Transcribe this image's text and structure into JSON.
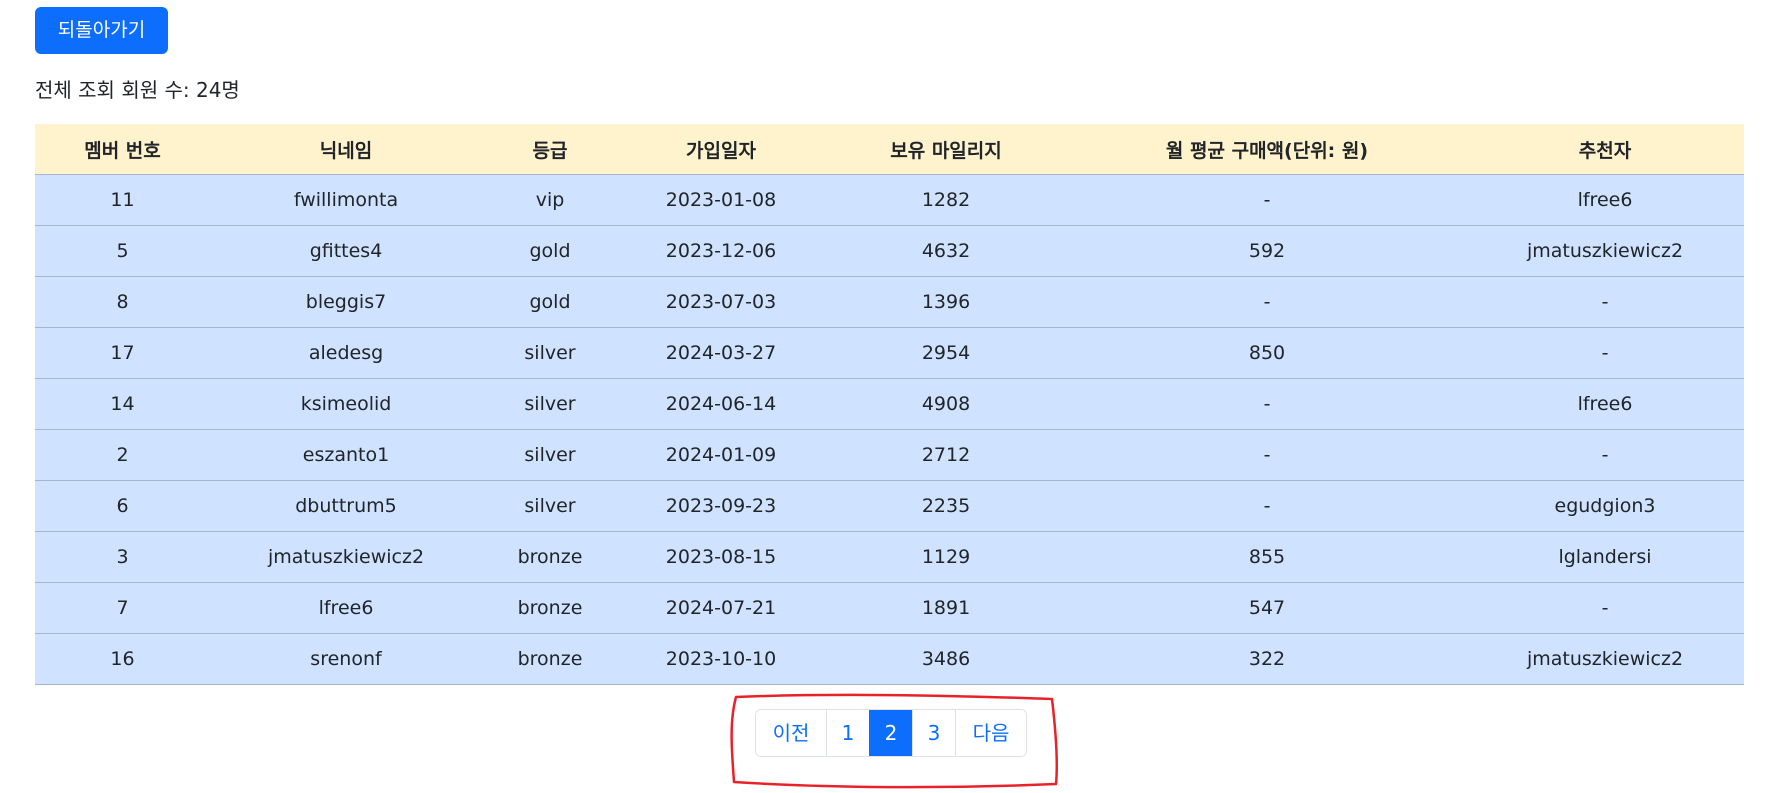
{
  "back_button": {
    "label": "되돌아가기"
  },
  "summary": {
    "text": "전체 조회 회원 수: 24명"
  },
  "table": {
    "headers": [
      "멤버 번호",
      "닉네임",
      "등급",
      "가입일자",
      "보유 마일리지",
      "월 평균 구매액(단위: 원)",
      "추천자"
    ],
    "rows": [
      [
        "11",
        "fwillimonta",
        "vip",
        "2023-01-08",
        "1282",
        "-",
        "lfree6"
      ],
      [
        "5",
        "gfittes4",
        "gold",
        "2023-12-06",
        "4632",
        "592",
        "jmatuszkiewicz2"
      ],
      [
        "8",
        "bleggis7",
        "gold",
        "2023-07-03",
        "1396",
        "-",
        "-"
      ],
      [
        "17",
        "aledesg",
        "silver",
        "2024-03-27",
        "2954",
        "850",
        "-"
      ],
      [
        "14",
        "ksimeolid",
        "silver",
        "2024-06-14",
        "4908",
        "-",
        "lfree6"
      ],
      [
        "2",
        "eszanto1",
        "silver",
        "2024-01-09",
        "2712",
        "-",
        "-"
      ],
      [
        "6",
        "dbuttrum5",
        "silver",
        "2023-09-23",
        "2235",
        "-",
        "egudgion3"
      ],
      [
        "3",
        "jmatuszkiewicz2",
        "bronze",
        "2023-08-15",
        "1129",
        "855",
        "lglandersi"
      ],
      [
        "7",
        "lfree6",
        "bronze",
        "2024-07-21",
        "1891",
        "547",
        "-"
      ],
      [
        "16",
        "srenonf",
        "bronze",
        "2023-10-10",
        "3486",
        "322",
        "jmatuszkiewicz2"
      ]
    ]
  },
  "pagination": {
    "prev_label": "이전",
    "pages": [
      "1",
      "2",
      "3"
    ],
    "active_page": "2",
    "next_label": "다음"
  },
  "colors": {
    "primary": "#0d6efd",
    "header_bg": "#fff3cd",
    "row_bg": "#cfe2ff",
    "annotation": "#e8222a"
  }
}
